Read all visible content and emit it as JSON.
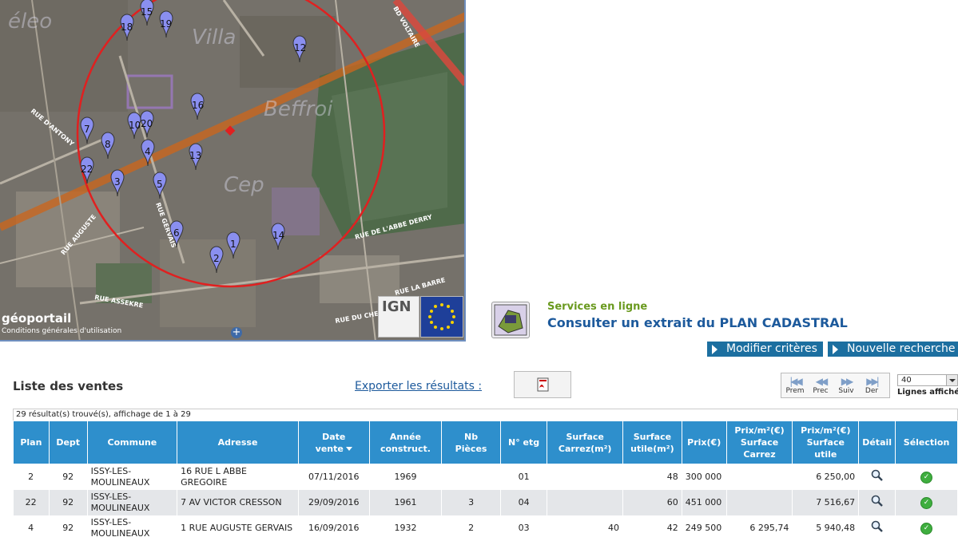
{
  "map": {
    "logo_text": "géoportail",
    "terms": "Conditions générales d'utilisation",
    "ign_label": "IGN",
    "zoom_plus": "+",
    "pins": [
      "15",
      "18",
      "19",
      "12",
      "16",
      "10",
      "20",
      "7",
      "8",
      "4",
      "13",
      "22",
      "3",
      "5",
      "6",
      "1",
      "14",
      "2"
    ],
    "road_labels": [
      "BD VOLTAIRE",
      "RUE D'ANTONY",
      "RUE AUGUSTE",
      "RUE DE L'ABBE DERRY",
      "RUE LA BARRE",
      "RUE ASSEKRE",
      "RUE DU CHEV",
      "RUE GERVAIS"
    ],
    "big_labels": [
      "éleo",
      "Beffroi",
      "Villa",
      "Cep"
    ]
  },
  "services": {
    "label": "Services en ligne",
    "link": "Consulter un extrait du PLAN CADASTRAL",
    "icon": "cadastre-map-icon"
  },
  "actions": {
    "modify": "Modifier critères",
    "new_search": "Nouvelle recherche"
  },
  "list": {
    "title": "Liste des ventes",
    "export_label": "Exporter les résultats :",
    "export_icon": "pdf-icon",
    "result_count": "29 résultat(s) trouvé(s), affichage de 1 à 29"
  },
  "pager": {
    "first": "Prem",
    "prev": "Prec",
    "next": "Suiv",
    "last": "Der",
    "lines_value": "40",
    "lines_label": "Lignes affichées"
  },
  "table": {
    "headers": {
      "plan": "Plan",
      "dept": "Dept",
      "commune": "Commune",
      "adresse": "Adresse",
      "date_l1": "Date",
      "date_l2": "vente",
      "annee_l1": "Année",
      "annee_l2": "construct.",
      "pieces_l1": "Nb",
      "pieces_l2": "Pièces",
      "etage": "N° etg",
      "carrez_l1": "Surface",
      "carrez_l2": "Carrez(m²)",
      "utile_l1": "Surface",
      "utile_l2": "utile(m²)",
      "prix": "Prix(€)",
      "pm2c_l1": "Prix/m²(€)",
      "pm2c_l2": "Surface",
      "pm2c_l3": "Carrez",
      "pm2u_l1": "Prix/m²(€)",
      "pm2u_l2": "Surface",
      "pm2u_l3": "utile",
      "detail": "Détail",
      "selection": "Sélection"
    },
    "rows": [
      {
        "plan": "2",
        "dept": "92",
        "commune_l1": "ISSY-LES-",
        "commune_l2": "MOULINEAUX",
        "adresse": "16 RUE L ABBE GREGOIRE",
        "date": "07/11/2016",
        "annee": "1969",
        "pieces": "",
        "etage": "01",
        "carrez": "",
        "utile": "48",
        "prix": "300 000",
        "pm2c": "",
        "pm2u": "6 250,00"
      },
      {
        "plan": "22",
        "dept": "92",
        "commune_l1": "ISSY-LES-",
        "commune_l2": "MOULINEAUX",
        "adresse": "7 AV VICTOR CRESSON",
        "date": "29/09/2016",
        "annee": "1961",
        "pieces": "3",
        "etage": "04",
        "carrez": "",
        "utile": "60",
        "prix": "451 000",
        "pm2c": "",
        "pm2u": "7 516,67"
      },
      {
        "plan": "4",
        "dept": "92",
        "commune_l1": "ISSY-LES-",
        "commune_l2": "MOULINEAUX",
        "adresse": "1 RUE AUGUSTE GERVAIS",
        "date": "16/09/2016",
        "annee": "1932",
        "pieces": "2",
        "etage": "03",
        "carrez": "40",
        "utile": "42",
        "prix": "249 500",
        "pm2c": "6 295,74",
        "pm2u": "5 940,48"
      }
    ]
  }
}
